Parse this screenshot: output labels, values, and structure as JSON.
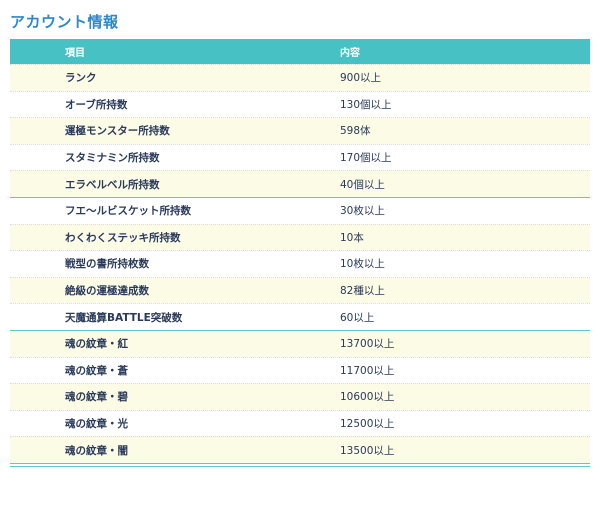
{
  "title": "アカウント情報",
  "table": {
    "headers": {
      "item": "項目",
      "content": "内容"
    },
    "rows": [
      {
        "item": "ランク",
        "value": "900以上"
      },
      {
        "item": "オーブ所持数",
        "value": "130個以上"
      },
      {
        "item": "運極モンスター所持数",
        "value": "598体"
      },
      {
        "item": "スタミナミン所持数",
        "value": "170個以上"
      },
      {
        "item": "エラベルベル所持数",
        "value": "40個以上"
      },
      {
        "item": "フエ〜ルビスケット所持数",
        "value": "30枚以上"
      },
      {
        "item": "わくわくステッキ所持数",
        "value": "10本"
      },
      {
        "item": "戦型の書所持枚数",
        "value": "10枚以上"
      },
      {
        "item": "絶級の運極達成数",
        "value": "82種以上"
      },
      {
        "item": "天魔通算BATTLE突破数",
        "value": "60以上"
      },
      {
        "item": "魂の紋章・紅",
        "value": "13700以上"
      },
      {
        "item": "魂の紋章・蒼",
        "value": "11700以上"
      },
      {
        "item": "魂の紋章・碧",
        "value": "10600以上"
      },
      {
        "item": "魂の紋章・光",
        "value": "12500以上"
      },
      {
        "item": "魂の紋章・闇",
        "value": "13500以上"
      }
    ]
  },
  "colors": {
    "title": "#2e87c9",
    "header_bg": "#47c1c4",
    "odd_row_bg": "#fbfbe6",
    "text": "#2a3a5a"
  }
}
